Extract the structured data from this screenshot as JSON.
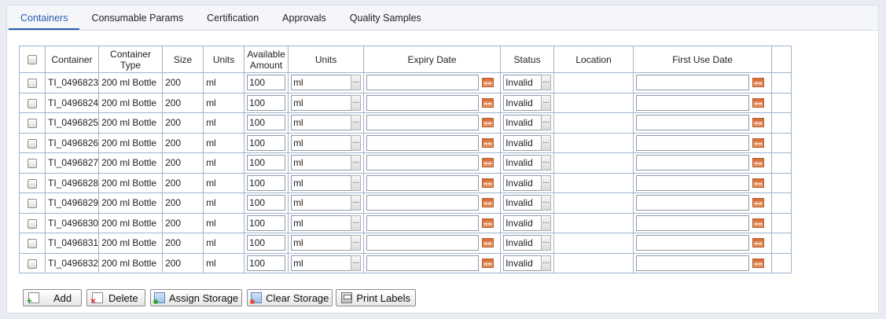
{
  "tabs": [
    {
      "label": "Containers",
      "active": true
    },
    {
      "label": "Consumable Params",
      "active": false
    },
    {
      "label": "Certification",
      "active": false
    },
    {
      "label": "Approvals",
      "active": false
    },
    {
      "label": "Quality Samples",
      "active": false
    }
  ],
  "columns": {
    "container": "Container",
    "container_type_line1": "Container",
    "container_type_line2": "Type",
    "size": "Size",
    "units": "Units",
    "available_line1": "Available",
    "available_line2": "Amount",
    "units2": "Units",
    "expiry": "Expiry Date",
    "status": "Status",
    "location": "Location",
    "first_use": "First Use Date"
  },
  "rows": [
    {
      "container": "TI_0496823",
      "type": "200 ml Bottle",
      "size": "200",
      "units": "ml",
      "amount": "100",
      "unit_select": "ml",
      "expiry": "",
      "status": "Invalid",
      "location": "",
      "first_use": ""
    },
    {
      "container": "TI_0496824",
      "type": "200 ml Bottle",
      "size": "200",
      "units": "ml",
      "amount": "100",
      "unit_select": "ml",
      "expiry": "",
      "status": "Invalid",
      "location": "",
      "first_use": ""
    },
    {
      "container": "TI_0496825",
      "type": "200 ml Bottle",
      "size": "200",
      "units": "ml",
      "amount": "100",
      "unit_select": "ml",
      "expiry": "",
      "status": "Invalid",
      "location": "",
      "first_use": ""
    },
    {
      "container": "TI_0496826",
      "type": "200 ml Bottle",
      "size": "200",
      "units": "ml",
      "amount": "100",
      "unit_select": "ml",
      "expiry": "",
      "status": "Invalid",
      "location": "",
      "first_use": ""
    },
    {
      "container": "TI_0496827",
      "type": "200 ml Bottle",
      "size": "200",
      "units": "ml",
      "amount": "100",
      "unit_select": "ml",
      "expiry": "",
      "status": "Invalid",
      "location": "",
      "first_use": ""
    },
    {
      "container": "TI_0496828",
      "type": "200 ml Bottle",
      "size": "200",
      "units": "ml",
      "amount": "100",
      "unit_select": "ml",
      "expiry": "",
      "status": "Invalid",
      "location": "",
      "first_use": ""
    },
    {
      "container": "TI_0496829",
      "type": "200 ml Bottle",
      "size": "200",
      "units": "ml",
      "amount": "100",
      "unit_select": "ml",
      "expiry": "",
      "status": "Invalid",
      "location": "",
      "first_use": ""
    },
    {
      "container": "TI_0496830",
      "type": "200 ml Bottle",
      "size": "200",
      "units": "ml",
      "amount": "100",
      "unit_select": "ml",
      "expiry": "",
      "status": "Invalid",
      "location": "",
      "first_use": ""
    },
    {
      "container": "TI_0496831",
      "type": "200 ml Bottle",
      "size": "200",
      "units": "ml",
      "amount": "100",
      "unit_select": "ml",
      "expiry": "",
      "status": "Invalid",
      "location": "",
      "first_use": ""
    },
    {
      "container": "TI_0496832",
      "type": "200 ml Bottle",
      "size": "200",
      "units": "ml",
      "amount": "100",
      "unit_select": "ml",
      "expiry": "",
      "status": "Invalid",
      "location": "",
      "first_use": ""
    }
  ],
  "lookup_button": "...",
  "buttons": {
    "add": "Add",
    "delete": "Delete",
    "assign_storage": "Assign Storage",
    "clear_storage": "Clear Storage",
    "print_labels": "Print Labels"
  },
  "icons": {
    "add": "add-icon",
    "delete": "delete-icon",
    "assign_storage": "assign-storage-icon",
    "clear_storage": "clear-storage-icon",
    "print_labels": "printer-icon",
    "calendar": "calendar-icon"
  },
  "colors": {
    "accent": "#2a5db0",
    "grid_border": "#9fb3d0",
    "calendar": "#e59060"
  }
}
